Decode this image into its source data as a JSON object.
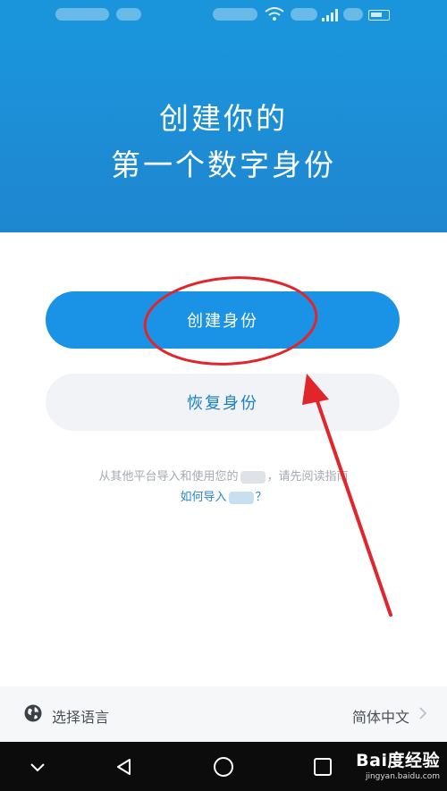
{
  "hero": {
    "line1": "创建你的",
    "line2": "第一个数字身份"
  },
  "actions": {
    "create_label": "创建身份",
    "restore_label": "恢复身份"
  },
  "hint": {
    "line1_prefix": "从其他平台导入和使用您的",
    "line1_suffix": "，请先阅读指南",
    "link_prefix": "如何导入",
    "link_suffix": "？"
  },
  "language": {
    "label": "选择语言",
    "value": "简体中文"
  },
  "watermark": {
    "brand": "Bai度经验",
    "url": "jingyan.baidu.com"
  },
  "colors": {
    "primary": "#1a93e6",
    "hero": "#1a95dc",
    "annotation": "#e0262b"
  },
  "icons": {
    "status_wifi": "wifi-icon",
    "status_signal": "signal-icon",
    "globe": "globe-icon",
    "nav_back": "back-triangle-icon",
    "nav_home": "home-circle-icon",
    "nav_recent": "recent-square-icon",
    "nav_down": "chevron-down-icon"
  }
}
